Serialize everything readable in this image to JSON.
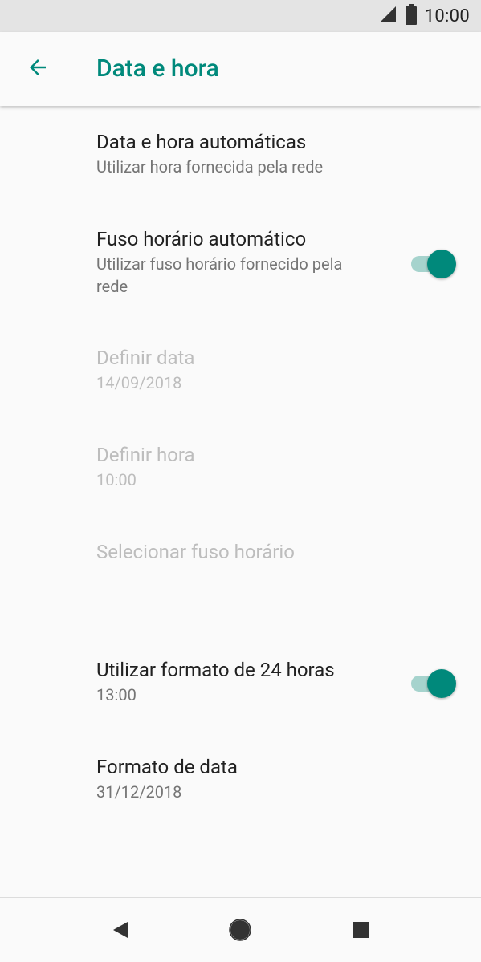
{
  "status_bar": {
    "time": "10:00",
    "signal_icon": "signal-icon",
    "battery_icon": "battery-icon"
  },
  "app_bar": {
    "title": "Data e hora",
    "back_icon": "arrow-back-icon"
  },
  "prefs": {
    "auto_datetime": {
      "title": "Data e hora automáticas",
      "summary": "Utilizar hora fornecida pela rede"
    },
    "auto_timezone": {
      "title": "Fuso horário automático",
      "summary": "Utilizar fuso horário fornecido pela rede",
      "switch_on": true
    },
    "set_date": {
      "title": "Definir data",
      "summary": "14/09/2018",
      "enabled": false
    },
    "set_time": {
      "title": "Definir hora",
      "summary": "10:00",
      "enabled": false
    },
    "select_timezone": {
      "title": "Selecionar fuso horário",
      "enabled": false
    },
    "use_24h": {
      "title": "Utilizar formato de 24 horas",
      "summary": "13:00",
      "switch_on": true
    },
    "date_format": {
      "title": "Formato de data",
      "summary": "31/12/2018"
    }
  },
  "nav_bar": {
    "back": "nav-back-icon",
    "home": "nav-home-icon",
    "recents": "nav-recents-icon"
  },
  "colors": {
    "accent": "#00897b",
    "accent_track": "#a6d3cd",
    "text_primary": "#212121",
    "text_secondary": "#757575",
    "text_disabled": "#bdbdbd"
  }
}
